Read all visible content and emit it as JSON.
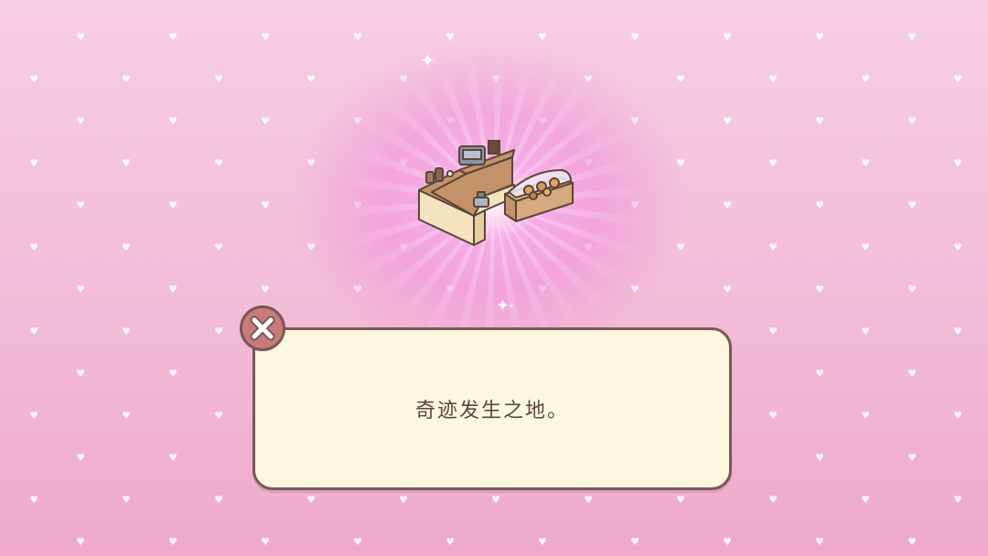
{
  "scene": {
    "type": "item-reveal",
    "background_color": "#f3bcd6",
    "glow_color": "#f08cdc",
    "item_icon": "cafe-counter-with-bakery-display-icon"
  },
  "dialog": {
    "message": "奇迹发生之地。",
    "close_icon": "close-icon",
    "text_color": "#5e4640",
    "panel_color": "#fdf7df",
    "button_color": "#c97b7c"
  }
}
